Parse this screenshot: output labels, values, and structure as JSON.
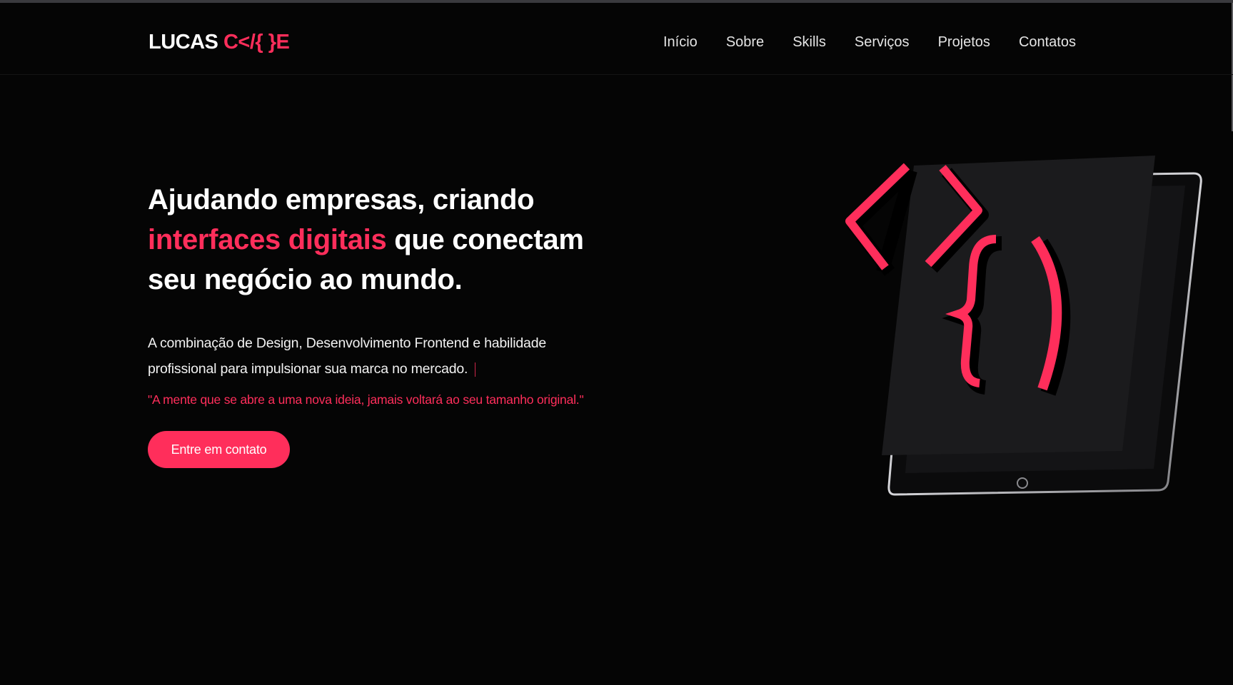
{
  "brand": {
    "name_light": "LUCAS ",
    "name_accent": "C</{ }E",
    "accent_color": "#ff2e5b"
  },
  "nav": {
    "items": [
      {
        "label": "Início"
      },
      {
        "label": "Sobre"
      },
      {
        "label": "Skills"
      },
      {
        "label": "Serviços"
      },
      {
        "label": "Projetos"
      },
      {
        "label": "Contatos"
      }
    ]
  },
  "hero": {
    "title_line1": "Ajudando empresas, criando",
    "title_accent": "interfaces digitais",
    "title_rest": " que conectam seu negócio ao mundo.",
    "description": "A combinação de Design, Desenvolvimento Frontend e habilidade profissional para impulsionar sua marca no mercado.",
    "quote": "\"A mente que se abre a uma nova ideia, jamais voltará ao seu tamanho original.\"",
    "cta_label": "Entre em contato"
  },
  "illustration": {
    "icon": "tablet-code-icon"
  }
}
